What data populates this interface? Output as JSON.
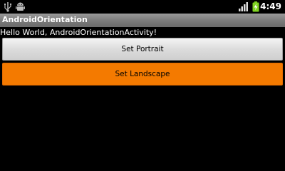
{
  "status_bar": {
    "time": "4:49",
    "icons": [
      "usb-icon",
      "android-debug-icon",
      "signal-icon",
      "battery-charging-icon"
    ]
  },
  "app": {
    "title": "AndroidOrientation"
  },
  "content": {
    "hello_text": "Hello World, AndroidOrientationActivity!",
    "buttons": {
      "portrait_label": "Set Portrait",
      "landscape_label": "Set Landscape"
    }
  },
  "colors": {
    "accent": "#f47a00",
    "background": "#000000",
    "title_bar": "#7a7a7a"
  }
}
